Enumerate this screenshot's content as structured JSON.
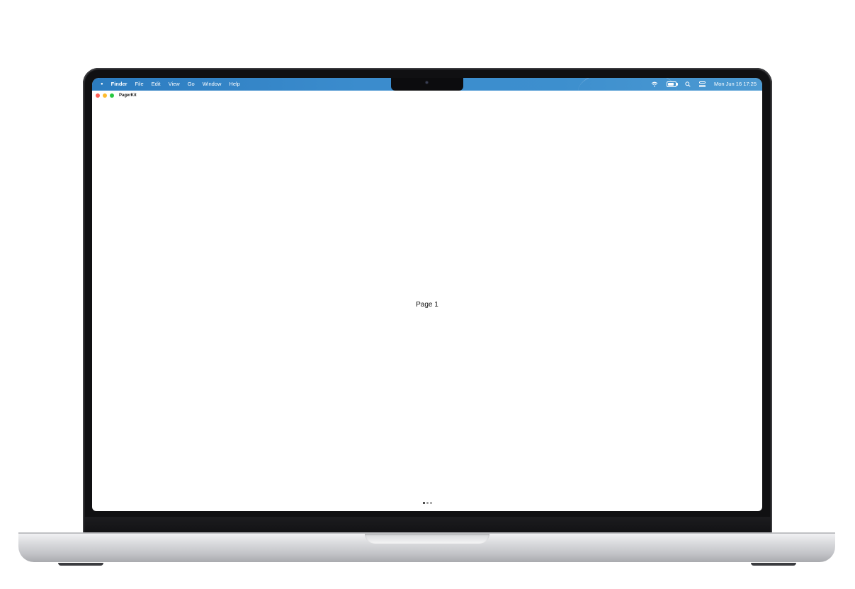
{
  "menubar": {
    "app_name": "Finder",
    "items": [
      "File",
      "Edit",
      "View",
      "Go",
      "Window",
      "Help"
    ],
    "datetime": "Mon Jun 16  17:25"
  },
  "window": {
    "title": "PagerKit",
    "page_label": "Page 1"
  },
  "pager": {
    "total_pages": 3,
    "current_page": 1
  },
  "icons": {
    "apple": "apple-icon",
    "wifi": "wifi-icon",
    "battery": "battery-icon",
    "search": "search-icon",
    "control_center": "control-center-icon"
  }
}
